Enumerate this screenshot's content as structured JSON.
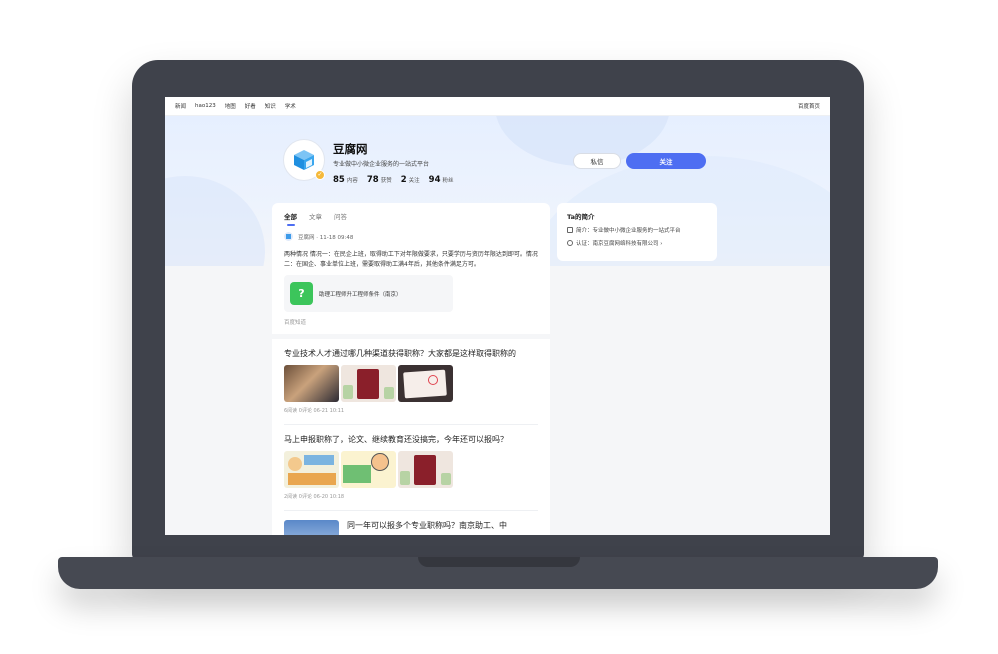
{
  "topnav": {
    "links": [
      "新闻",
      "hao123",
      "地图",
      "好看",
      "知识",
      "学术"
    ],
    "right_link": "百度首页"
  },
  "profile": {
    "name": "豆腐网",
    "description": "专业做中小微企业服务的一站式平台",
    "stats": [
      {
        "value": "85",
        "label": "内容"
      },
      {
        "value": "78",
        "label": "获赞"
      },
      {
        "value": "2",
        "label": "关注"
      },
      {
        "value": "94",
        "label": "粉丝"
      }
    ]
  },
  "actions": {
    "message_label": "私信",
    "follow_label": "关注"
  },
  "feed": {
    "tabs": [
      "全部",
      "文章",
      "问答"
    ],
    "post": {
      "author_meta": "豆腐网 · 11-18 09:48",
      "text": "两种情况 情况一：在民企上班，取得助工下对年限做要求，只要学历与资历年限达到即可。情况二：在国企、事业单位上班，需要取得助工满4年后，其他条件满足方可。",
      "card_icon": "?",
      "card_title": "助理工程师升工程师条件（南京）",
      "source": "百度知道"
    },
    "articles": [
      {
        "title": "专业技术人才通过哪几种渠道获得职称？大家都是这样取得职称的",
        "meta": "6阅读 0评论 06-21 10:11"
      },
      {
        "title": "马上申报职称了，论文、继续教育还没搞完，今年还可以报吗？",
        "meta": "2阅读 0评论 06-20 10:18"
      }
    ],
    "partial_article": {
      "title": "同一年可以报多个专业职称吗？南京助工、中"
    }
  },
  "intro": {
    "title": "Ta的简介",
    "summary": "简介：专业做中小微企业服务的一站式平台",
    "certification": "认证：南京豆腐网络科技有限公司 ›"
  },
  "colors": {
    "accent": "#4e6ef2",
    "laptop_frame": "#3f424b",
    "banner": "#e6efff"
  },
  "icons": {
    "avatar": "cube-logo-icon",
    "avatar_badge": "verified-badge-icon",
    "card": "question-icon",
    "intro_summary": "document-icon",
    "intro_cert": "certified-icon"
  }
}
